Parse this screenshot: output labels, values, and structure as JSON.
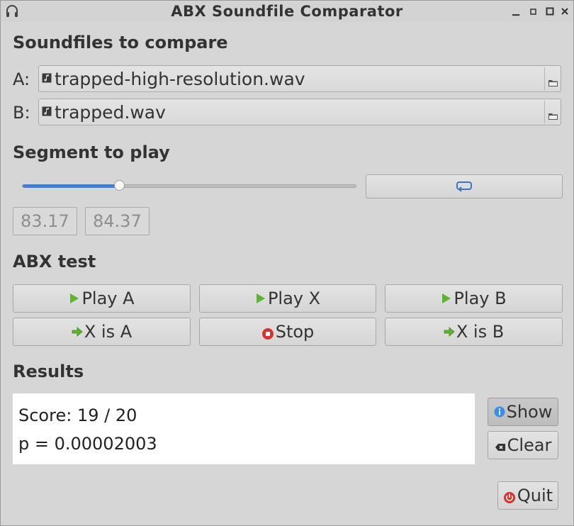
{
  "window": {
    "title": "ABX Soundfile Comparator",
    "controls": [
      "minimize",
      "maximize",
      "close"
    ]
  },
  "files": {
    "heading": "Soundfiles to compare",
    "a": {
      "label": "A:",
      "filename": "trapped-high-resolution.wav"
    },
    "b": {
      "label": "B:",
      "filename": "trapped.wav"
    }
  },
  "segment": {
    "heading": "Segment to play",
    "slider_position": 0.29,
    "start": "83.17",
    "end": "84.37"
  },
  "abx": {
    "heading": "ABX test",
    "play_a": "Play A",
    "play_x": "Play X",
    "play_b": "Play B",
    "x_is_a": "X is A",
    "stop": "Stop",
    "x_is_b": "X is B"
  },
  "results": {
    "heading": "Results",
    "score": "Score: 19 / 20",
    "p_value": "p = 0.00002003",
    "show_label": "Show",
    "clear_label": "Clear"
  },
  "quit_label": "Quit",
  "colors": {
    "accent": "#3d80d8",
    "play_green": "#4caf50",
    "stop_red": "#d93030",
    "info_blue": "#3a8ee6"
  }
}
